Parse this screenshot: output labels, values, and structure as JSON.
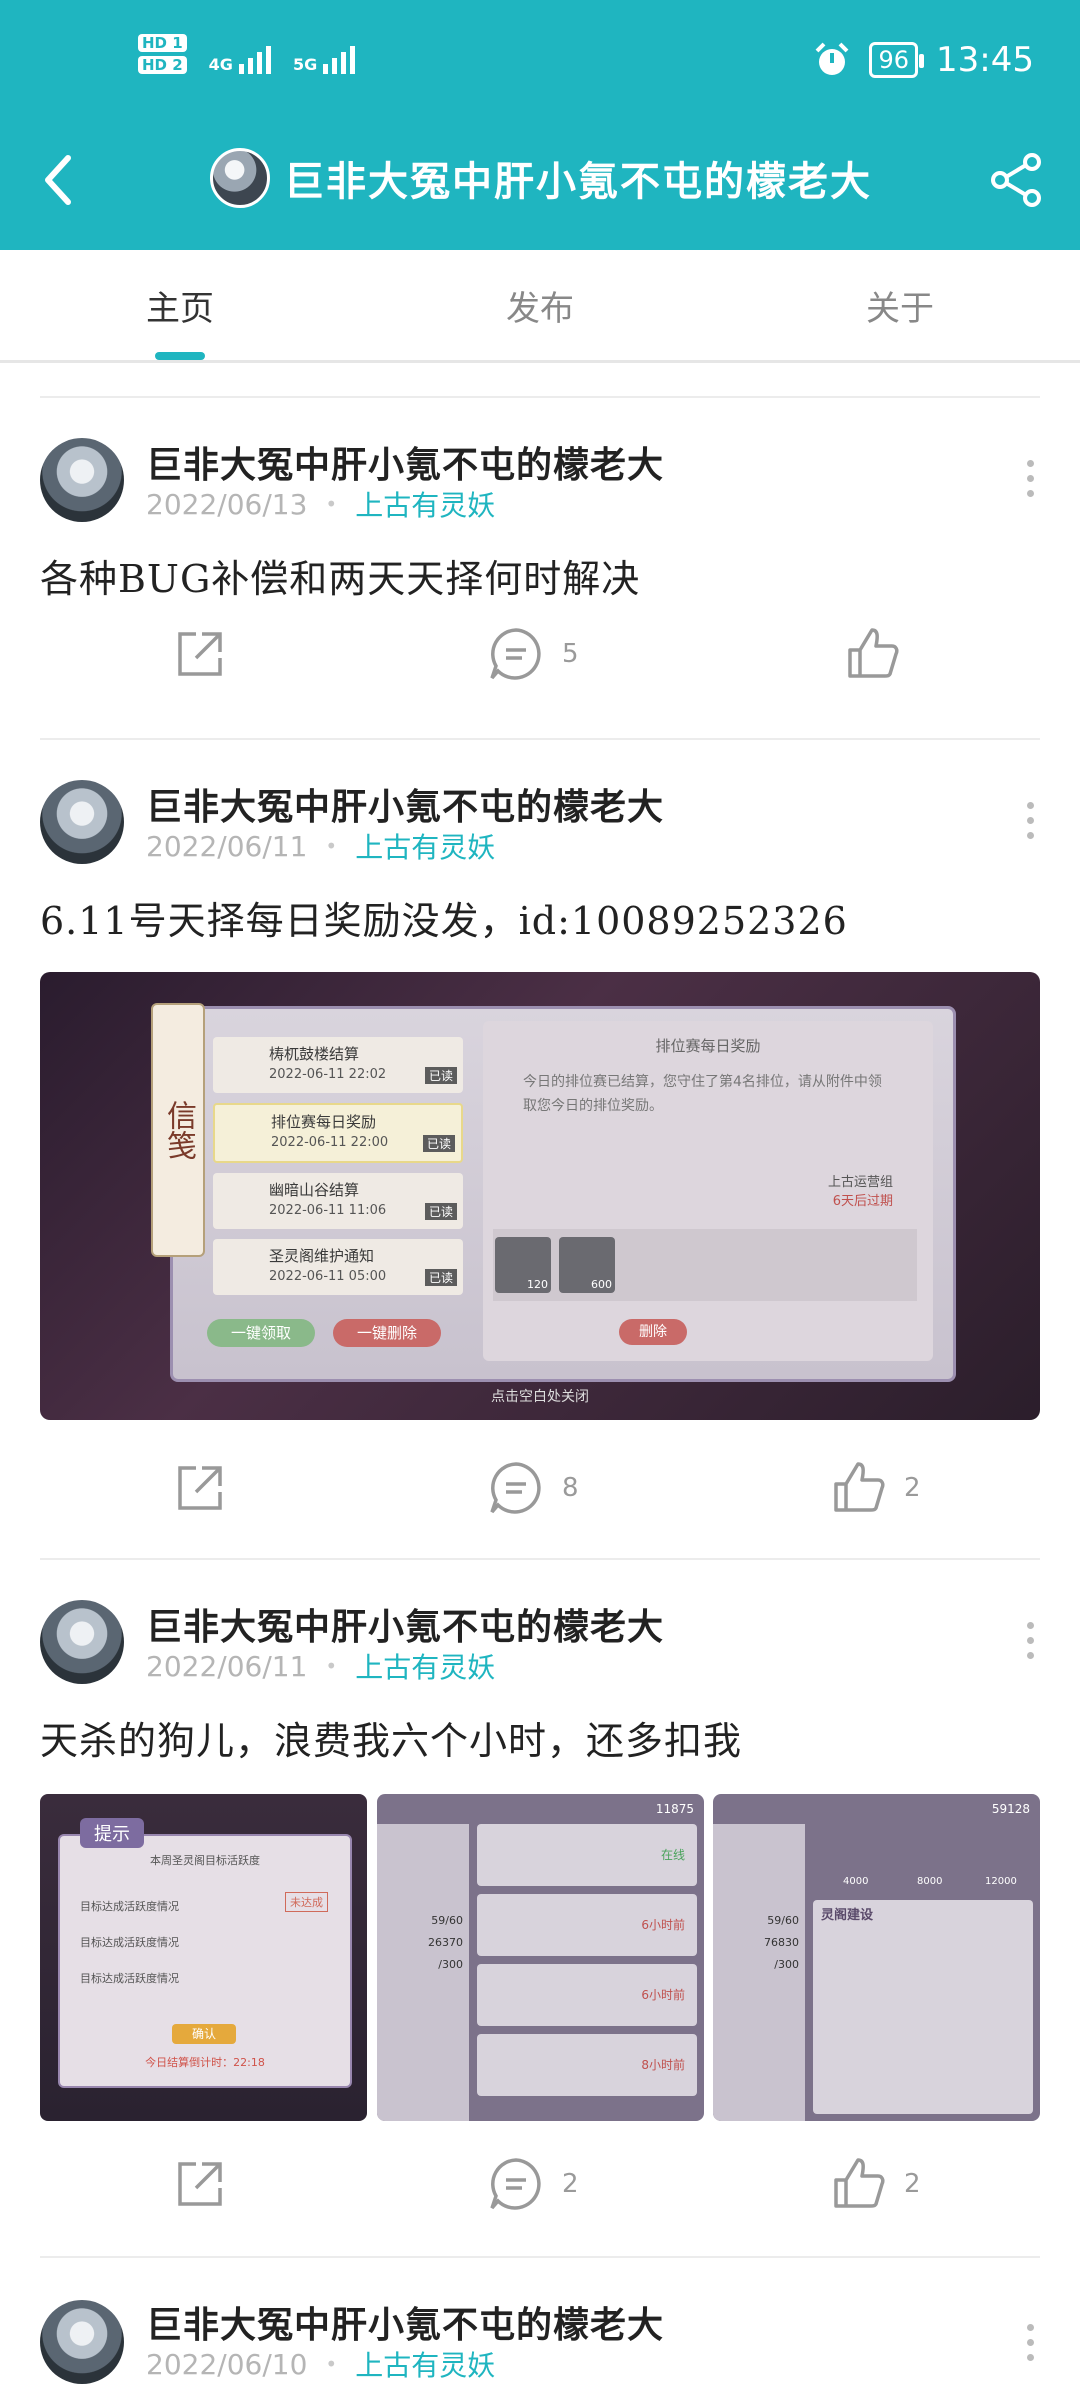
{
  "status_bar": {
    "time": "13:45",
    "battery": "96",
    "net1": "4G",
    "net2": "5G",
    "sim1": "HD 1",
    "sim2": "HD 2"
  },
  "app_bar": {
    "title": "巨非大冤中肝小氪不屯的檬老大"
  },
  "tabs": [
    {
      "label": "主页"
    },
    {
      "label": "发布"
    },
    {
      "label": "关于"
    }
  ],
  "posts": [
    {
      "author": "巨非大冤中肝小氪不屯的檬老大",
      "date": "2022/06/13",
      "dot": "•",
      "group": "上古有灵妖",
      "text": "各种BUG补偿和两天天择何时解决",
      "comments": "5",
      "likes": ""
    },
    {
      "author": "巨非大冤中肝小氪不屯的檬老大",
      "date": "2022/06/11",
      "dot": "•",
      "group": "上古有灵妖",
      "text": "6.11号天择每日奖励没发，id:10089252326",
      "comments": "8",
      "likes": "2",
      "image": {
        "side_label": "信笺",
        "list": [
          {
            "title": "梼杌鼓楼结算",
            "time": "2022-06-11 22:02",
            "tag": "已读"
          },
          {
            "title": "排位赛每日奖励",
            "time": "2022-06-11 22:00",
            "tag": "已读"
          },
          {
            "title": "幽暗山谷结算",
            "time": "2022-06-11 11:06",
            "tag": "已读"
          },
          {
            "title": "圣灵阁维护通知",
            "time": "2022-06-11 05:00",
            "tag": "已读"
          }
        ],
        "panel_title": "排位赛每日奖励",
        "panel_body": "今日的排位赛已结算，您守住了第4名排位，请从附件中领取您今日的排位奖励。",
        "sender": "上古运营组",
        "expire": "6天后过期",
        "reward1": "120",
        "reward2": "600",
        "btn_claim": "一键领取",
        "btn_delete_all": "一键删除",
        "btn_delete": "删除",
        "close_hint": "点击空白处关闭"
      }
    },
    {
      "author": "巨非大冤中肝小氪不屯的檬老大",
      "date": "2022/06/11",
      "dot": "•",
      "group": "上古有灵妖",
      "text": "天杀的狗儿，浪费我六个小时，还多扣我",
      "comments": "2",
      "likes": "2",
      "thumbs": [
        {
          "title": "提示",
          "line1": "本周圣灵阁目标活跃度",
          "row1": "目标达成活跃度情况",
          "row2": "目标达成活跃度情况",
          "row3": "目标达成活跃度情况",
          "btn": "确认",
          "footer": "今日结算倒计时：22:18",
          "stamp": "未达成"
        },
        {
          "coins": "11875",
          "n1": "59/60",
          "n2": "26370",
          "n3": "/300",
          "status1": "在线",
          "status2": "6小时前",
          "status3": "6小时前",
          "status4": "8小时前"
        },
        {
          "coins": "59128",
          "header": "灵阁建设",
          "n1": "59/60",
          "n2": "76830",
          "n3": "/300",
          "vals": [
            "4000",
            "8000",
            "12000"
          ]
        }
      ]
    },
    {
      "author": "巨非大冤中肝小氪不屯的檬老大",
      "date": "2022/06/10",
      "dot": "•",
      "group": "上古有灵妖"
    }
  ],
  "colors": {
    "accent": "#1fb5c0",
    "text": "#222222",
    "muted": "#9a9a9a"
  },
  "icons": {
    "back": "chevron-left-icon",
    "share": "share-icon",
    "forward": "forward-icon",
    "comment": "comment-icon",
    "like": "thumbs-up-icon",
    "more": "more-vertical-icon"
  }
}
